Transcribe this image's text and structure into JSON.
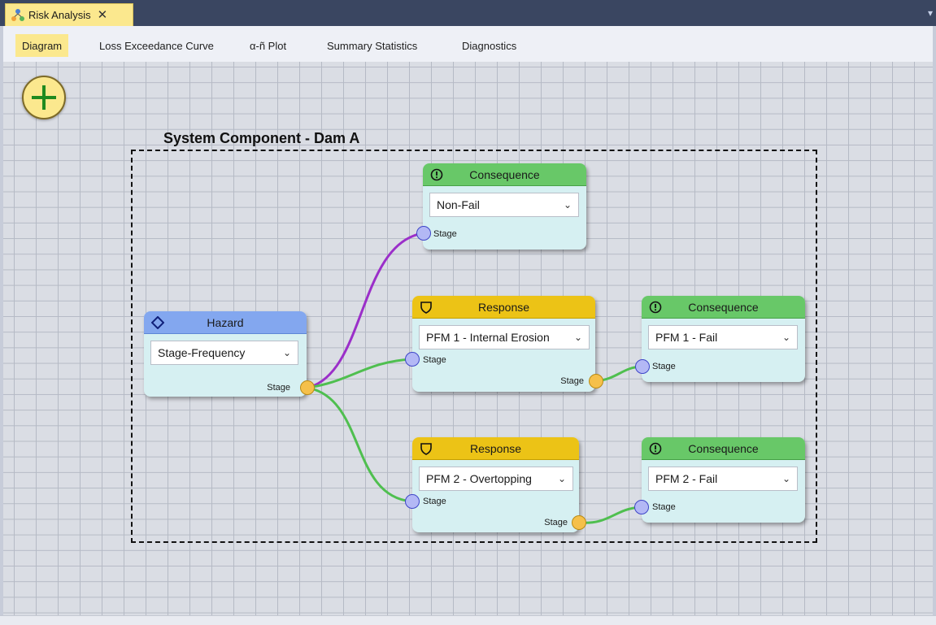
{
  "window": {
    "tab_title": "Risk Analysis",
    "tab_icon": "risk-analysis-icon",
    "close_glyph": "✕",
    "overflow_glyph": "▾"
  },
  "tabs": [
    {
      "label": "Diagram",
      "active": true
    },
    {
      "label": "Loss Exceedance Curve",
      "active": false
    },
    {
      "label": "α-ñ Plot",
      "active": false
    },
    {
      "label": "Summary Statistics",
      "active": false
    },
    {
      "label": "Diagnostics",
      "active": false
    }
  ],
  "canvas": {
    "add_button_icon": "plus-icon",
    "group_title": "System Component - Dam A"
  },
  "nodes": {
    "hazard": {
      "title": "Hazard",
      "icon": "diamond-icon",
      "selection": "Stage-Frequency",
      "out_label": "Stage"
    },
    "consequence_top": {
      "title": "Consequence",
      "icon": "alert-circle-icon",
      "selection": "Non-Fail",
      "in_label": "Stage"
    },
    "response_1": {
      "title": "Response",
      "icon": "shield-icon",
      "selection": "PFM 1 - Internal Erosion",
      "in_label": "Stage",
      "out_label": "Stage"
    },
    "consequence_1": {
      "title": "Consequence",
      "icon": "alert-circle-icon",
      "selection": "PFM 1 - Fail",
      "in_label": "Stage"
    },
    "response_2": {
      "title": "Response",
      "icon": "shield-icon",
      "selection": "PFM 2 - Overtopping",
      "in_label": "Stage",
      "out_label": "Stage"
    },
    "consequence_2": {
      "title": "Consequence",
      "icon": "alert-circle-icon",
      "selection": "PFM 2 - Fail",
      "in_label": "Stage"
    }
  },
  "colors": {
    "hazard_header": "#83a7ef",
    "consequence_header": "#68c868",
    "response_header": "#ecc316",
    "node_body": "#d6f0f2",
    "wire_purple": "#9b2fc9",
    "wire_green": "#4fbf4f",
    "tab_active": "#fbe88e"
  }
}
